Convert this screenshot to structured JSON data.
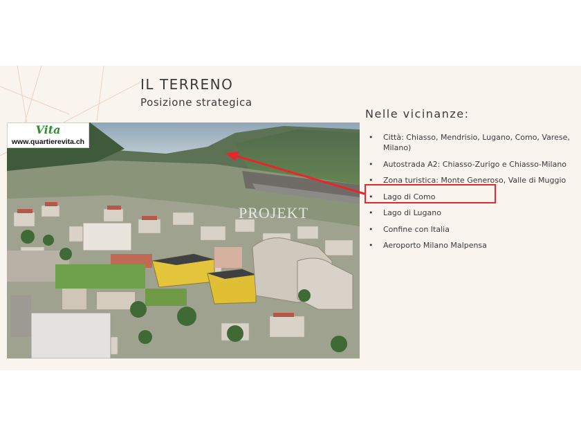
{
  "slide": {
    "title": "IL TERRENO",
    "subtitle": "Posizione strategica"
  },
  "logo": {
    "brand": "Vita",
    "url": "www.quartierevita.ch"
  },
  "watermark": "PROJEKT",
  "nearby": {
    "heading": "Nelle vicinanze:",
    "items": [
      "Città: Chiasso, Mendrisio, Lugano, Como, Varese, Milano)",
      "Autostrada A2: Chiasso-Zurigo e Chiasso-Milano",
      "Zona turistica: Monte Generoso, Valle di Muggio",
      "Lago di Como",
      "Lago di Lugano",
      "Confine con Italia",
      "Aeroporto Milano Malpensa"
    ],
    "highlighted_item": "Lago di Como"
  },
  "colors": {
    "background": "#faf4ef",
    "highlight": "#e8262a",
    "accent_lines": "#e9c9b6"
  }
}
